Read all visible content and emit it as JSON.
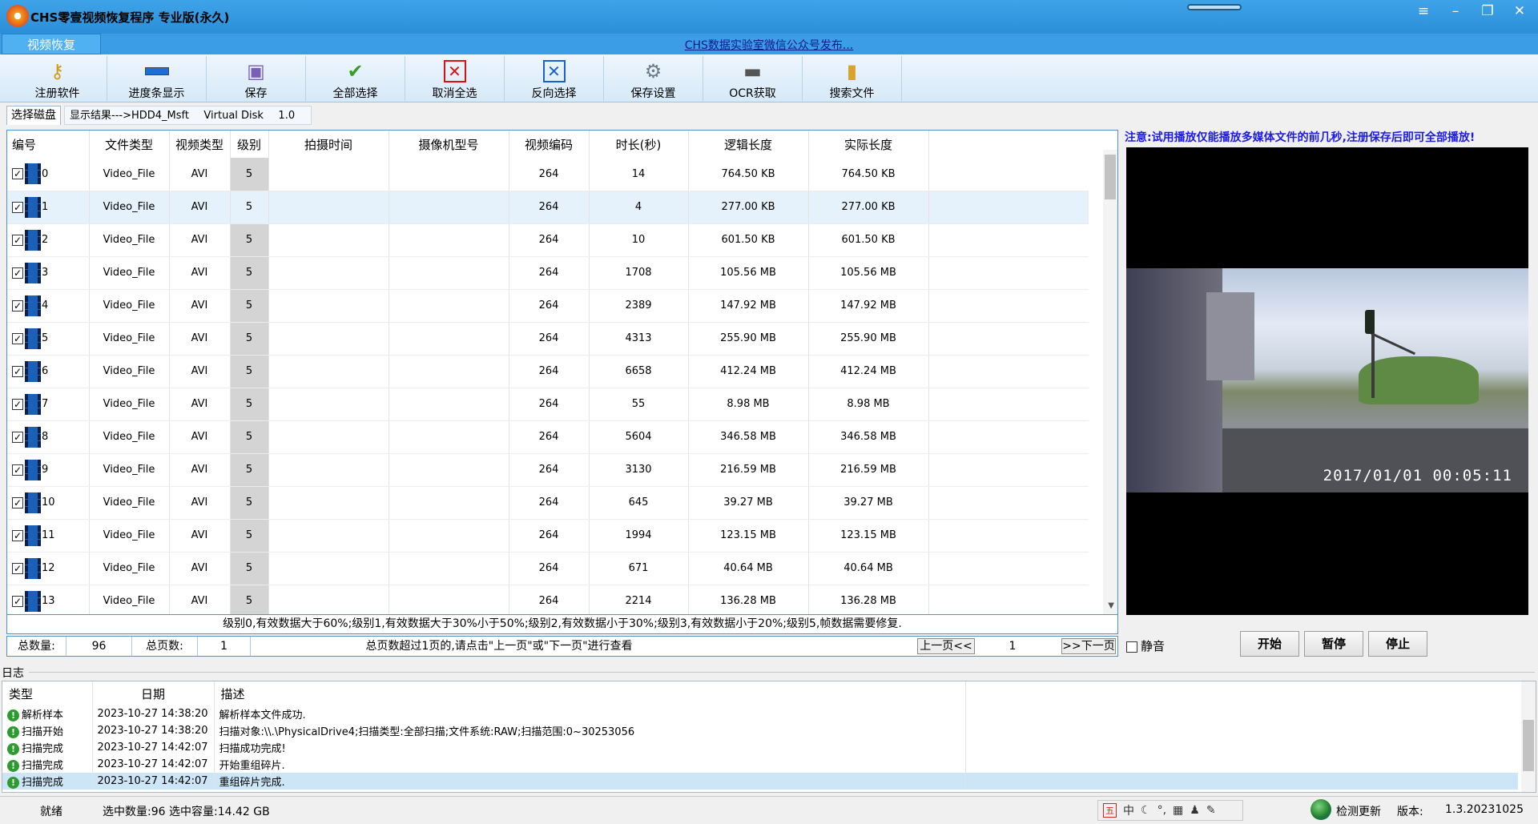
{
  "window": {
    "title": "CHS零壹视频恢复程序 专业版(永久)",
    "controls": [
      "≡",
      "–",
      "❐",
      "✕"
    ]
  },
  "menu": {
    "tab": "视频恢复",
    "publish_link": "CHS数据实验室微信公众号发布..."
  },
  "toolbar": [
    {
      "label": "注册软件",
      "icon": "key-icon"
    },
    {
      "label": "进度条显示",
      "icon": "progress-icon"
    },
    {
      "label": "保存",
      "icon": "save-icon"
    },
    {
      "label": "全部选择",
      "icon": "check-icon"
    },
    {
      "label": "取消全选",
      "icon": "cancel-icon"
    },
    {
      "label": "反向选择",
      "icon": "invert-icon"
    },
    {
      "label": "保存设置",
      "icon": "settings-icon"
    },
    {
      "label": "OCR获取",
      "icon": "ocr-icon"
    },
    {
      "label": "搜索文件",
      "icon": "search-file-icon"
    }
  ],
  "tabs": {
    "select_disk": "选择磁盘",
    "result_label": "显示结果--->HDD4_Msft",
    "disk_name": "Virtual Disk",
    "disk_version": "1.0"
  },
  "table": {
    "columns": [
      "编号",
      "文件类型",
      "视频类型",
      "级别",
      "拍摄时间",
      "摄像机型号",
      "视频编码",
      "时长(秒)",
      "逻辑长度",
      "实际长度"
    ],
    "rows": [
      {
        "id": "0",
        "ftype": "Video_File",
        "vtype": "AVI",
        "level": "5",
        "shot_time": "",
        "camera": "",
        "codec": "264",
        "duration": "14",
        "logical": "764.50 KB",
        "actual": "764.50 KB"
      },
      {
        "id": "1",
        "ftype": "Video_File",
        "vtype": "AVI",
        "level": "5",
        "shot_time": "",
        "camera": "",
        "codec": "264",
        "duration": "4",
        "logical": "277.00 KB",
        "actual": "277.00 KB"
      },
      {
        "id": "2",
        "ftype": "Video_File",
        "vtype": "AVI",
        "level": "5",
        "shot_time": "",
        "camera": "",
        "codec": "264",
        "duration": "10",
        "logical": "601.50 KB",
        "actual": "601.50 KB"
      },
      {
        "id": "3",
        "ftype": "Video_File",
        "vtype": "AVI",
        "level": "5",
        "shot_time": "",
        "camera": "",
        "codec": "264",
        "duration": "1708",
        "logical": "105.56 MB",
        "actual": "105.56 MB"
      },
      {
        "id": "4",
        "ftype": "Video_File",
        "vtype": "AVI",
        "level": "5",
        "shot_time": "",
        "camera": "",
        "codec": "264",
        "duration": "2389",
        "logical": "147.92 MB",
        "actual": "147.92 MB"
      },
      {
        "id": "5",
        "ftype": "Video_File",
        "vtype": "AVI",
        "level": "5",
        "shot_time": "",
        "camera": "",
        "codec": "264",
        "duration": "4313",
        "logical": "255.90 MB",
        "actual": "255.90 MB"
      },
      {
        "id": "6",
        "ftype": "Video_File",
        "vtype": "AVI",
        "level": "5",
        "shot_time": "",
        "camera": "",
        "codec": "264",
        "duration": "6658",
        "logical": "412.24 MB",
        "actual": "412.24 MB"
      },
      {
        "id": "7",
        "ftype": "Video_File",
        "vtype": "AVI",
        "level": "5",
        "shot_time": "",
        "camera": "",
        "codec": "264",
        "duration": "55",
        "logical": "8.98 MB",
        "actual": "8.98 MB"
      },
      {
        "id": "8",
        "ftype": "Video_File",
        "vtype": "AVI",
        "level": "5",
        "shot_time": "",
        "camera": "",
        "codec": "264",
        "duration": "5604",
        "logical": "346.58 MB",
        "actual": "346.58 MB"
      },
      {
        "id": "9",
        "ftype": "Video_File",
        "vtype": "AVI",
        "level": "5",
        "shot_time": "",
        "camera": "",
        "codec": "264",
        "duration": "3130",
        "logical": "216.59 MB",
        "actual": "216.59 MB"
      },
      {
        "id": "10",
        "ftype": "Video_File",
        "vtype": "AVI",
        "level": "5",
        "shot_time": "",
        "camera": "",
        "codec": "264",
        "duration": "645",
        "logical": "39.27 MB",
        "actual": "39.27 MB"
      },
      {
        "id": "11",
        "ftype": "Video_File",
        "vtype": "AVI",
        "level": "5",
        "shot_time": "",
        "camera": "",
        "codec": "264",
        "duration": "1994",
        "logical": "123.15 MB",
        "actual": "123.15 MB"
      },
      {
        "id": "12",
        "ftype": "Video_File",
        "vtype": "AVI",
        "level": "5",
        "shot_time": "",
        "camera": "",
        "codec": "264",
        "duration": "671",
        "logical": "40.64 MB",
        "actual": "40.64 MB"
      },
      {
        "id": "13",
        "ftype": "Video_File",
        "vtype": "AVI",
        "level": "5",
        "shot_time": "",
        "camera": "",
        "codec": "264",
        "duration": "2214",
        "logical": "136.28 MB",
        "actual": "136.28 MB"
      }
    ],
    "selected_row": 1
  },
  "legend": "级别0,有效数据大于60%;级别1,有效数据大于30%小于50%;级别2,有效数据小于30%;级别3,有效数据小于20%;级别5,帧数据需要修复.",
  "stats": {
    "total_label": "总数量:",
    "total_value": "96",
    "pages_label": "总页数:",
    "pages_value": "1",
    "hint": "总页数超过1页的,请点击\"上一页\"或\"下一页\"进行查看",
    "prev": "上一页<<",
    "page_value": "1",
    "next": ">>下一页"
  },
  "preview": {
    "notice": "注意:试用播放仅能播放多媒体文件的前几秒,注册保存后即可全部播放!",
    "timestamp": "2017/01/01  00:05:11",
    "mute_label": "静音",
    "start": "开始",
    "pause": "暂停",
    "stop": "停止"
  },
  "log": {
    "title": "日志",
    "columns": [
      "类型",
      "日期",
      "描述"
    ],
    "rows": [
      {
        "type": "解析样本",
        "date": "2023-10-27 14:38:20",
        "desc": "解析样本文件成功."
      },
      {
        "type": "扫描开始",
        "date": "2023-10-27 14:38:20",
        "desc": "扫描对象:\\\\.\\PhysicalDrive4;扫描类型:全部扫描;文件系统:RAW;扫描范围:0~30253056"
      },
      {
        "type": "扫描完成",
        "date": "2023-10-27 14:42:07",
        "desc": "扫描成功完成!"
      },
      {
        "type": "扫描完成",
        "date": "2023-10-27 14:42:07",
        "desc": "开始重组碎片."
      },
      {
        "type": "扫描完成",
        "date": "2023-10-27 14:42:07",
        "desc": "重组碎片完成."
      }
    ],
    "selected_row": 4
  },
  "status": {
    "ready": "就绪",
    "selection": "选中数量:96 选中容量:14.42 GB",
    "ime_five": "五",
    "ime_zh": "中",
    "check_update": "检测更新",
    "version_label": "版本:",
    "version_value": "1.3.20231025"
  }
}
